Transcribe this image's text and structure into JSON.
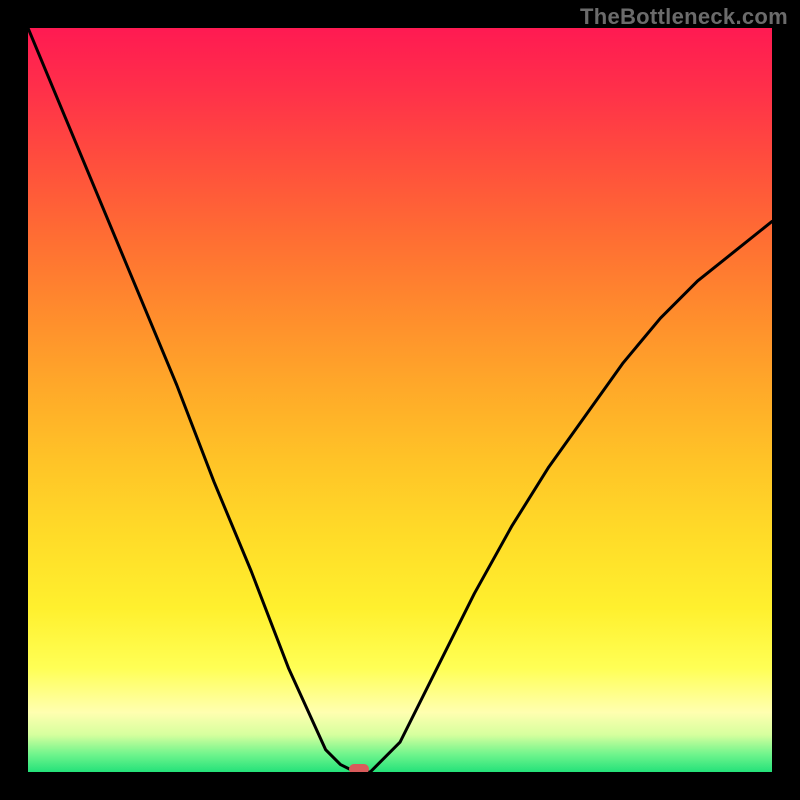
{
  "watermark": "TheBottleneck.com",
  "chart_data": {
    "type": "line",
    "title": "",
    "xlabel": "",
    "ylabel": "",
    "xlim": [
      0,
      1
    ],
    "ylim": [
      0,
      1
    ],
    "x": [
      0.0,
      0.05,
      0.1,
      0.15,
      0.2,
      0.25,
      0.3,
      0.35,
      0.4,
      0.42,
      0.44,
      0.45,
      0.46,
      0.5,
      0.55,
      0.6,
      0.65,
      0.7,
      0.75,
      0.8,
      0.85,
      0.9,
      0.95,
      1.0
    ],
    "values": [
      1.0,
      0.88,
      0.76,
      0.64,
      0.52,
      0.39,
      0.27,
      0.14,
      0.03,
      0.01,
      0.0,
      0.0,
      0.0,
      0.04,
      0.14,
      0.24,
      0.33,
      0.41,
      0.48,
      0.55,
      0.61,
      0.66,
      0.7,
      0.74
    ],
    "marker": {
      "x": 0.445,
      "y": 0.0
    },
    "background": "rainbow-vertical-gradient"
  },
  "colors": {
    "curve": "#000000",
    "marker": "#d95b5b",
    "frame": "#000000"
  }
}
